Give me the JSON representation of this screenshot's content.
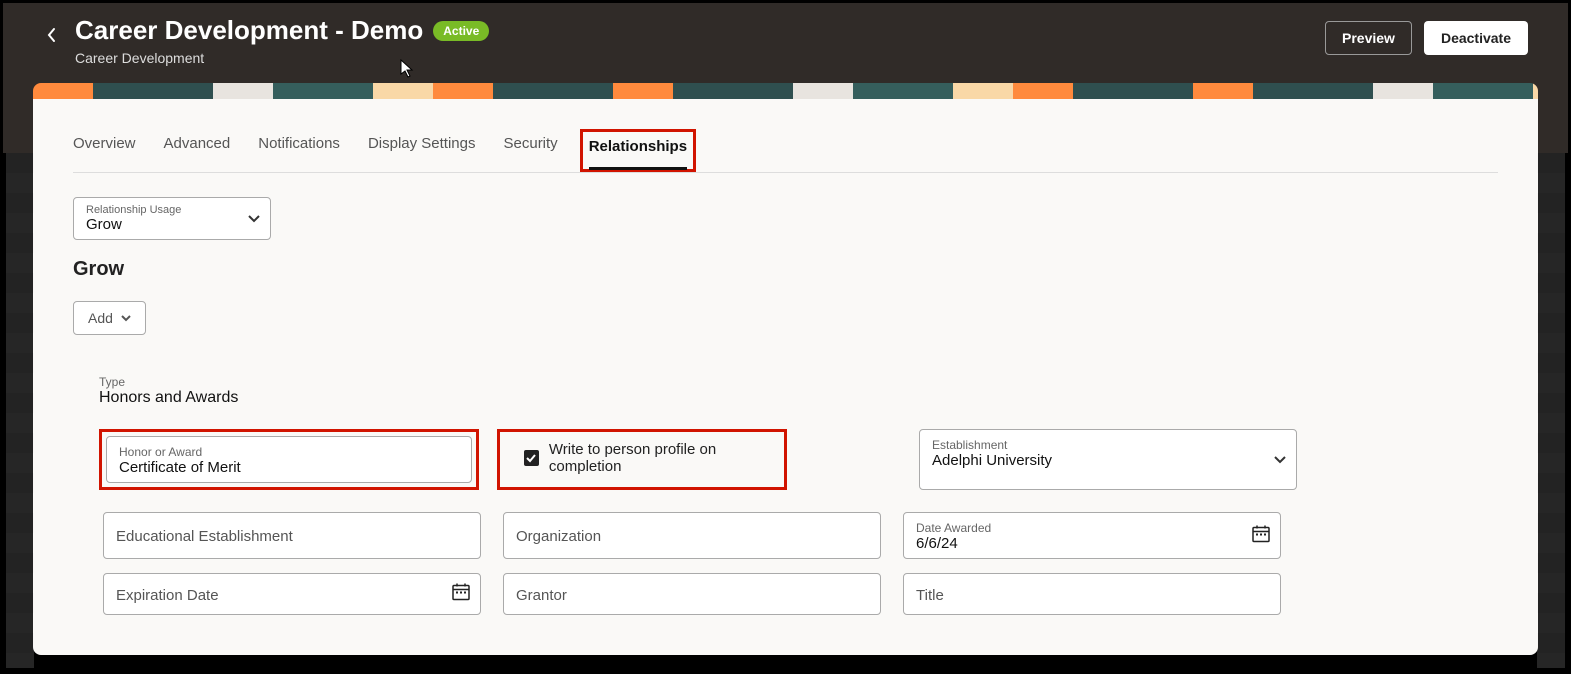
{
  "header": {
    "title": "Career Development - Demo",
    "subtitle": "Career Development",
    "badge": "Active",
    "preview_label": "Preview",
    "deactivate_label": "Deactivate"
  },
  "tabs": {
    "overview": "Overview",
    "advanced": "Advanced",
    "notifications": "Notifications",
    "display_settings": "Display Settings",
    "security": "Security",
    "relationships": "Relationships"
  },
  "relationship_usage": {
    "label": "Relationship Usage",
    "value": "Grow"
  },
  "section_heading": "Grow",
  "add_label": "Add",
  "type": {
    "label": "Type",
    "value": "Honors and Awards"
  },
  "honor_award": {
    "label": "Honor or Award",
    "value": "Certificate of Merit"
  },
  "write_profile": {
    "label": "Write to person profile on completion",
    "checked": true
  },
  "establishment": {
    "label": "Establishment",
    "value": "Adelphi University"
  },
  "fields": {
    "educational_establishment": "Educational Establishment",
    "organization": "Organization",
    "date_awarded_label": "Date Awarded",
    "date_awarded_value": "6/6/24",
    "expiration_date": "Expiration Date",
    "grantor": "Grantor",
    "title": "Title"
  }
}
